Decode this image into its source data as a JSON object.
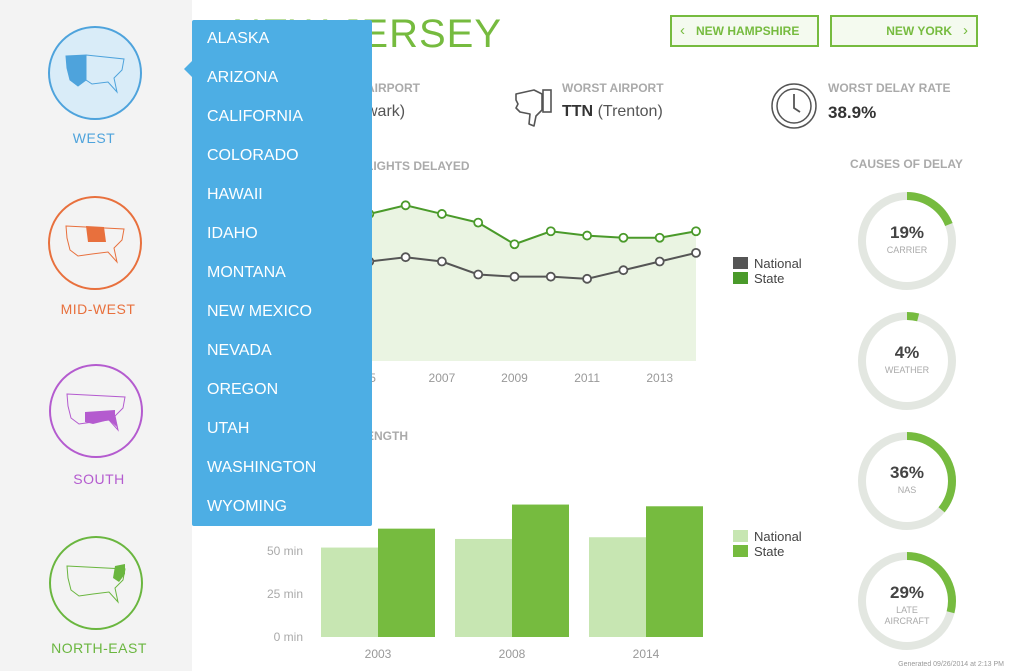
{
  "header": {
    "state_title": "NEW JERSEY",
    "prev_state": "NEW HAMPSHIRE",
    "next_state": "NEW YORK"
  },
  "regions": [
    {
      "label": "WEST",
      "color": "#4ea3dc",
      "selected": true
    },
    {
      "label": "MID-WEST",
      "color": "#e8703d"
    },
    {
      "label": "SOUTH",
      "color": "#b45bcf"
    },
    {
      "label": "NORTH-EAST",
      "color": "#6ab63f"
    }
  ],
  "dropdown": {
    "items": [
      "ALASKA",
      "ARIZONA",
      "CALIFORNIA",
      "COLORADO",
      "HAWAII",
      "IDAHO",
      "MONTANA",
      "NEW MEXICO",
      "NEVADA",
      "OREGON",
      "UTAH",
      "WASHINGTON",
      "WYOMING"
    ]
  },
  "stats": {
    "best_airport_heading": "AIRPORT",
    "best_airport_value": "wark)",
    "worst_airport_heading": "WORST AIRPORT",
    "worst_airport_code": "TTN",
    "worst_airport_name": "(Trenton)",
    "worst_delay_heading": "WORST DELAY RATE",
    "worst_delay_value": "38.9%"
  },
  "colors": {
    "accent": "#76bb3f",
    "national_line": "#555555",
    "state_line": "#4a9a2a",
    "bar_national": "#c7e6b2",
    "bar_state": "#76bb3f",
    "dropdown_bg": "#4daee4"
  },
  "chart_data": [
    {
      "type": "line",
      "title": "LIGHTS DELAYED",
      "x": [
        2004,
        2005,
        2006,
        2007,
        2008,
        2009,
        2010,
        2011,
        2012,
        2013,
        2014
      ],
      "x_tick_labels": [
        "05",
        "2007",
        "2009",
        "2011",
        "2013"
      ],
      "x_tick_values": [
        2005,
        2007,
        2009,
        2011,
        2013
      ],
      "series": [
        {
          "name": "National",
          "values": [
            21,
            23,
            24,
            23,
            20,
            19.5,
            19.5,
            19,
            21,
            23,
            25
          ]
        },
        {
          "name": "State",
          "values": [
            33,
            34,
            36,
            34,
            32,
            27,
            30,
            29,
            28.5,
            28.5,
            30
          ]
        }
      ],
      "legend": [
        "National",
        "State"
      ],
      "legend_position": "right",
      "ylim": [
        0,
        40
      ]
    },
    {
      "type": "bar",
      "title": "ENGTH",
      "categories": [
        "2003",
        "2008",
        "2014"
      ],
      "series": [
        {
          "name": "National",
          "values": [
            52,
            57,
            58
          ]
        },
        {
          "name": "State",
          "values": [
            63,
            77,
            76
          ]
        }
      ],
      "y_ticks": [
        0,
        25,
        50
      ],
      "y_tick_labels": [
        "0 min",
        "25 min",
        "50 min"
      ],
      "ylim": [
        0,
        75
      ],
      "legend": [
        "National",
        "State"
      ],
      "legend_position": "right"
    },
    {
      "type": "pie",
      "title": "CAUSES OF DELAY",
      "slices": [
        {
          "label": "CARRIER",
          "value": 19,
          "display": "19%"
        },
        {
          "label": "WEATHER",
          "value": 4,
          "display": "4%"
        },
        {
          "label": "NAS",
          "value": 36,
          "display": "36%"
        },
        {
          "label": "LATE AIRCRAFT",
          "value": 29,
          "display": "29%"
        }
      ]
    }
  ],
  "footer": {
    "generated": "Generated 09/26/2014 at 2:13 PM"
  }
}
